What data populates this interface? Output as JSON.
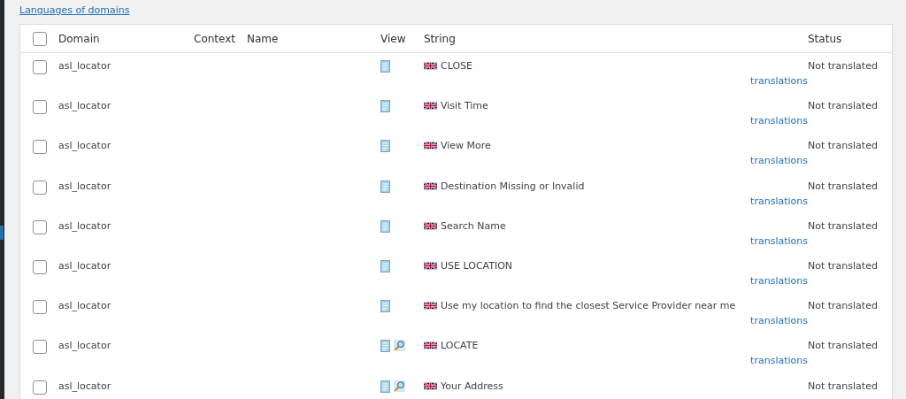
{
  "link": "Languages of domains",
  "table": {
    "select_all": {
      "checked": false
    },
    "columns": [
      "Domain",
      "Context",
      "Name",
      "View",
      "String",
      "Status"
    ],
    "rows": [
      {
        "checked": false,
        "domain": "asl_locator",
        "view": [
          {
            "kind": "document"
          }
        ],
        "string": "CLOSE",
        "action": "translations",
        "status": "Not translated"
      },
      {
        "checked": false,
        "domain": "asl_locator",
        "view": [
          {
            "kind": "document"
          }
        ],
        "string": "Visit Time",
        "action": "translations",
        "status": "Not translated"
      },
      {
        "checked": false,
        "domain": "asl_locator",
        "view": [
          {
            "kind": "document"
          }
        ],
        "string": "View More",
        "action": "translations",
        "status": "Not translated"
      },
      {
        "checked": false,
        "domain": "asl_locator",
        "view": [
          {
            "kind": "document"
          }
        ],
        "string": "Destination Missing or Invalid",
        "action": "translations",
        "status": "Not translated"
      },
      {
        "checked": false,
        "domain": "asl_locator",
        "view": [
          {
            "kind": "document"
          }
        ],
        "string": "Search Name",
        "action": "translations",
        "status": "Not translated"
      },
      {
        "checked": false,
        "domain": "asl_locator",
        "view": [
          {
            "kind": "document"
          }
        ],
        "string": "USE LOCATION",
        "action": "translations",
        "status": "Not translated"
      },
      {
        "checked": false,
        "domain": "asl_locator",
        "view": [
          {
            "kind": "document"
          }
        ],
        "string": "Use my location to find the closest Service Provider near me",
        "action": "translations",
        "status": "Not translated"
      },
      {
        "checked": false,
        "domain": "asl_locator",
        "view": [
          {
            "kind": "document"
          },
          {
            "kind": "magnifier"
          }
        ],
        "string": "LOCATE",
        "action": "translations",
        "status": "Not translated"
      },
      {
        "checked": false,
        "domain": "asl_locator",
        "view": [
          {
            "kind": "document"
          },
          {
            "kind": "magnifier"
          }
        ],
        "string": "Your Address",
        "status": "Not translated"
      }
    ]
  }
}
